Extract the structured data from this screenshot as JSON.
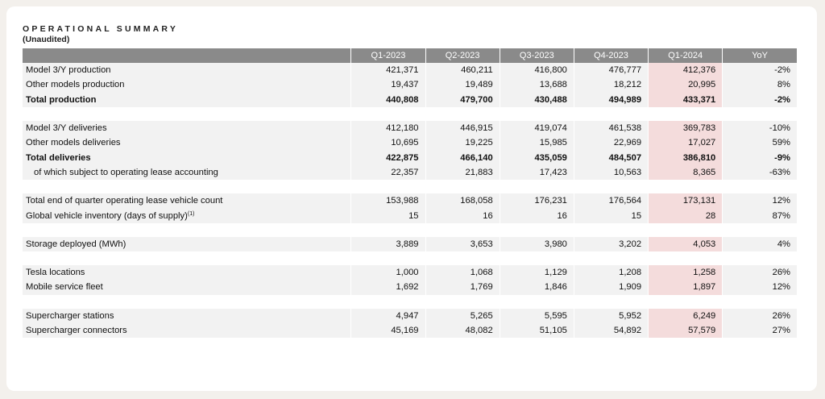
{
  "header": {
    "title": "OPERATIONAL SUMMARY",
    "subtitle": "(Unaudited)"
  },
  "columns": [
    "",
    "Q1-2023",
    "Q2-2023",
    "Q3-2023",
    "Q4-2023",
    "Q1-2024",
    "YoY"
  ],
  "rows": [
    {
      "label": "Model 3/Y production",
      "values": [
        "421,371",
        "460,211",
        "416,800",
        "476,777",
        "412,376",
        "-2%"
      ]
    },
    {
      "label": "Other models production",
      "values": [
        "19,437",
        "19,489",
        "13,688",
        "18,212",
        "20,995",
        "8%"
      ]
    },
    {
      "label": "Total production",
      "values": [
        "440,808",
        "479,700",
        "430,488",
        "494,989",
        "433,371",
        "-2%"
      ]
    },
    {
      "label": "Model 3/Y deliveries",
      "values": [
        "412,180",
        "446,915",
        "419,074",
        "461,538",
        "369,783",
        "-10%"
      ]
    },
    {
      "label": "Other models deliveries",
      "values": [
        "10,695",
        "19,225",
        "15,985",
        "22,969",
        "17,027",
        "59%"
      ]
    },
    {
      "label": "Total deliveries",
      "values": [
        "422,875",
        "466,140",
        "435,059",
        "484,507",
        "386,810",
        "-9%"
      ]
    },
    {
      "label": "of which subject to operating lease accounting",
      "values": [
        "22,357",
        "21,883",
        "17,423",
        "10,563",
        "8,365",
        "-63%"
      ]
    },
    {
      "label": "Total end of quarter operating lease vehicle count",
      "values": [
        "153,988",
        "168,058",
        "176,231",
        "176,564",
        "173,131",
        "12%"
      ]
    },
    {
      "label": "Global vehicle inventory (days of supply)",
      "footnote": "(1)",
      "values": [
        "15",
        "16",
        "16",
        "15",
        "28",
        "87%"
      ]
    },
    {
      "label": "Storage deployed (MWh)",
      "values": [
        "3,889",
        "3,653",
        "3,980",
        "3,202",
        "4,053",
        "4%"
      ]
    },
    {
      "label": "Tesla locations",
      "values": [
        "1,000",
        "1,068",
        "1,129",
        "1,208",
        "1,258",
        "26%"
      ]
    },
    {
      "label": "Mobile service fleet",
      "values": [
        "1,692",
        "1,769",
        "1,846",
        "1,909",
        "1,897",
        "12%"
      ]
    },
    {
      "label": "Supercharger stations",
      "values": [
        "4,947",
        "5,265",
        "5,595",
        "5,952",
        "6,249",
        "26%"
      ]
    },
    {
      "label": "Supercharger connectors",
      "values": [
        "45,169",
        "48,082",
        "51,105",
        "54,892",
        "57,579",
        "27%"
      ]
    }
  ],
  "colors": {
    "header_bg": "#8a8a8a",
    "row_bg": "#f2f2f2",
    "highlight_bg": "#f4dcdc",
    "page_bg": "#f3f0ec"
  }
}
